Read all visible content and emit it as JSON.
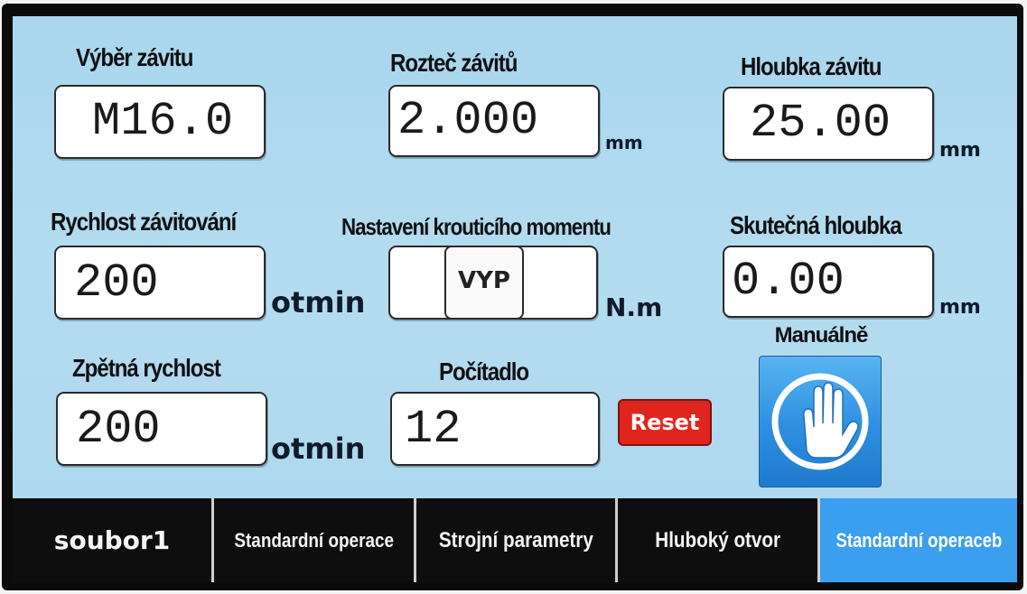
{
  "fields": {
    "thread_select": {
      "label": "Výběr závitu",
      "value": "M16.0"
    },
    "thread_pitch": {
      "label": "Rozteč závitů",
      "value": "2.000",
      "unit": "mm"
    },
    "thread_depth": {
      "label": "Hloubka závitu",
      "value": "25.00",
      "unit": "mm"
    },
    "tapping_speed": {
      "label": "Rychlost závitování",
      "value": "200",
      "unit": "otmin"
    },
    "torque": {
      "label": "Nastavení krouticího momentu",
      "value": "VYP",
      "unit": "N.m"
    },
    "actual_depth": {
      "label": "Skutečná hloubka",
      "value": "0.00",
      "unit": "mm"
    },
    "return_speed": {
      "label": "Zpětná rychlost",
      "value": "200",
      "unit": "otmin"
    },
    "counter": {
      "label": "Počítadlo",
      "value": "12"
    }
  },
  "buttons": {
    "reset": "Reset",
    "manual": "Manuálně"
  },
  "tabs": [
    {
      "label": "soubor1",
      "active": false
    },
    {
      "label": "Standardní operace",
      "active": false
    },
    {
      "label": "Strojní parametry",
      "active": false
    },
    {
      "label": "Hluboký otvor",
      "active": false
    },
    {
      "label": "Standardní operaceb",
      "active": true
    }
  ],
  "icons": {
    "manual": "hand-icon"
  },
  "colors": {
    "screen_bg": "#b4dcf1",
    "reset_bg": "#e0251d",
    "active_tab": "#3b9ff0",
    "tab_bg": "#0e0e0e"
  }
}
